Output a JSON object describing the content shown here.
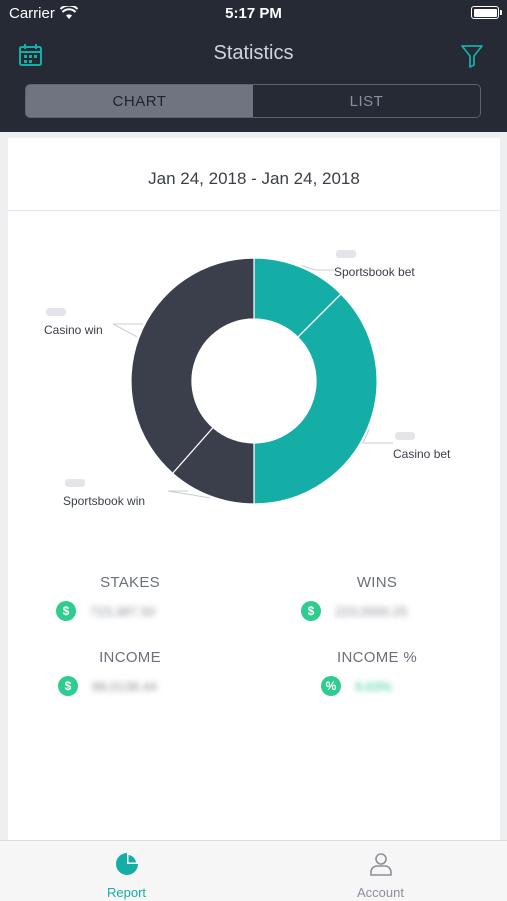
{
  "status_bar": {
    "carrier": "Carrier",
    "time": "5:17 PM"
  },
  "header": {
    "title": "Statistics",
    "left_icon": "calendar-icon",
    "right_icon": "filter-icon",
    "tabs": [
      {
        "label": "CHART",
        "selected": true
      },
      {
        "label": "LIST",
        "selected": false
      }
    ]
  },
  "date_range": "Jan 24, 2018 - Jan 24, 2018",
  "chart_data": {
    "type": "pie",
    "slices": [
      {
        "label": "Sportsbook bet",
        "share": 0.125,
        "color": "#14aea6"
      },
      {
        "label": "Casino bet",
        "share": 0.375,
        "color": "#14aea6"
      },
      {
        "label": "Sportsbook win",
        "share": 0.115,
        "color": "#3a3f4b"
      },
      {
        "label": "Casino win",
        "share": 0.385,
        "color": "#3a3f4b"
      }
    ],
    "percent_labels_obscured": true,
    "donut": true
  },
  "stats": {
    "stakes": {
      "label": "STAKES",
      "icon": "$",
      "value": "723,387.50"
    },
    "wins": {
      "label": "WINS",
      "icon": "$",
      "value": "223,0000.25"
    },
    "income": {
      "label": "INCOME",
      "icon": "$",
      "value": "88,0138.44"
    },
    "income_pct": {
      "label": "INCOME %",
      "icon": "%",
      "value": "9.63%"
    }
  },
  "tabbar": {
    "items": [
      {
        "label": "Report",
        "icon": "pie-chart-icon",
        "active": true
      },
      {
        "label": "Account",
        "icon": "user-icon",
        "active": false
      }
    ]
  },
  "colors": {
    "accent": "#14aea6",
    "dark": "#252a35",
    "badge": "#2ecc8f"
  }
}
